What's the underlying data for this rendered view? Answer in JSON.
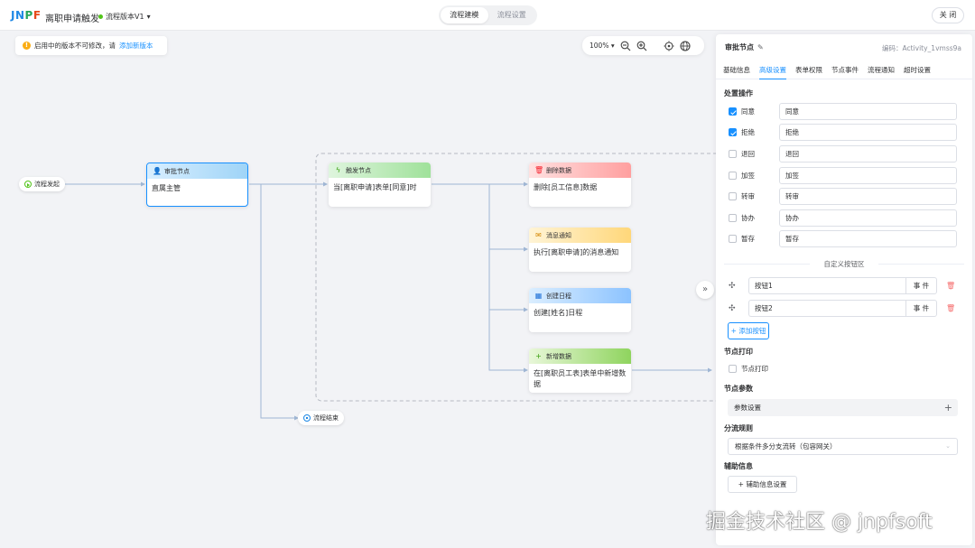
{
  "header": {
    "logo": "JNPF",
    "app_title": "离职申请触发",
    "version_label": "流程版本V1",
    "seg_tabs": [
      "流程建模",
      "流程设置"
    ],
    "close_label": "关 闭"
  },
  "notice": {
    "text": "启用中的版本不可修改，请",
    "link": "添加新版本"
  },
  "zoom": {
    "level": "100%"
  },
  "canvas": {
    "start_label": "流程发起",
    "end_label": "流程结束",
    "nodes": [
      {
        "title": "审批节点",
        "body": "直属主管",
        "color": "#1890ff"
      },
      {
        "title": "触发节点",
        "body": "当[离职申请]表单[同意]时",
        "color": "#52c41a"
      },
      {
        "title": "删除数据",
        "body": "删除[员工信息]数据",
        "color": "#ff4d4f"
      },
      {
        "title": "消息通知",
        "body": "执行[离职申请]的消息通知",
        "color": "#faad14"
      },
      {
        "title": "创建日程",
        "body": "创建[姓名]日程",
        "color": "#1890ff"
      },
      {
        "title": "新增数据",
        "body": "在[离职员工表]表单中新增数据",
        "color": "#52c41a"
      }
    ]
  },
  "panel": {
    "title": "审批节点",
    "code": "编码：Activity_1vmss9a",
    "tabs": [
      "基础信息",
      "高级设置",
      "表单权限",
      "节点事件",
      "流程通知",
      "超时设置"
    ],
    "active_tab": 1,
    "ops_title": "处置操作",
    "ops": [
      {
        "label": "同意",
        "value": "同意",
        "checked": true
      },
      {
        "label": "拒绝",
        "value": "拒绝",
        "checked": true
      },
      {
        "label": "退回",
        "value": "退回",
        "checked": false
      },
      {
        "label": "加签",
        "value": "加签",
        "checked": false
      },
      {
        "label": "转审",
        "value": "转审",
        "checked": false
      },
      {
        "label": "协办",
        "value": "协办",
        "checked": false
      },
      {
        "label": "暂存",
        "value": "暂存",
        "checked": false
      }
    ],
    "custom_area": "自定义按钮区",
    "custom_buttons": [
      {
        "value": "按钮1",
        "event": "事 件"
      },
      {
        "value": "按钮2",
        "event": "事 件"
      }
    ],
    "add_button": "+ 添加按钮",
    "print_title": "节点打印",
    "print_label": "节点打印",
    "param_title": "节点参数",
    "param_label": "参数设置",
    "branch_title": "分流规则",
    "branch_value": "根据条件多分支流转（包容网关）",
    "aux_title": "辅助信息",
    "aux_button": "+ 辅助信息设置"
  },
  "watermark": "掘金技术社区 @ jnpfsoft"
}
